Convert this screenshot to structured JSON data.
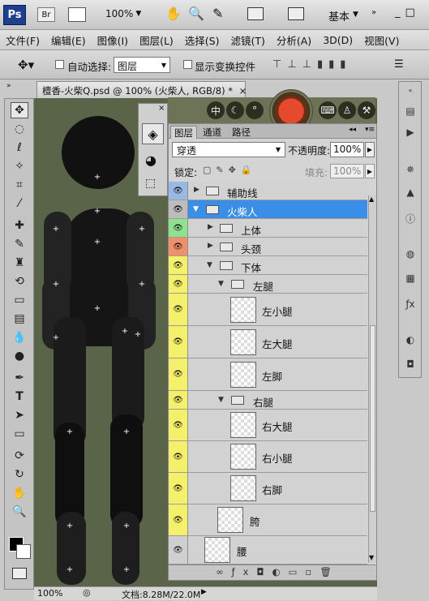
{
  "app": {
    "logo": "Ps",
    "bridge": "Br",
    "zoom": "100%",
    "workspace": "基本"
  },
  "menu": [
    "文件(F)",
    "编辑(E)",
    "图像(I)",
    "图层(L)",
    "选择(S)",
    "滤镜(T)",
    "分析(A)",
    "3D(D)",
    "视图(V)"
  ],
  "options": {
    "auto_select_label": "自动选择:",
    "auto_select_value": "图层",
    "show_transform_label": "显示变换控件"
  },
  "document": {
    "tab_title": "檀香-火柴Q.psd @ 100% (火柴人, RGB/8) *",
    "status_zoom": "100%",
    "status_doc": "文档:8.28M/22.0M"
  },
  "layers_panel": {
    "tabs": [
      "图层",
      "通道",
      "路径"
    ],
    "blend_mode": "穿透",
    "opacity_label": "不透明度:",
    "opacity_value": "100%",
    "lock_label": "锁定:",
    "fill_label": "填充:",
    "fill_value": "100%",
    "layers": [
      {
        "name": "辅助线",
        "kind": "group",
        "eye_color": "#9ab8e6"
      },
      {
        "name": "火柴人",
        "kind": "group",
        "eye_color": "#bdbdbd"
      },
      {
        "name": "上体",
        "kind": "group",
        "eye_color": "#8fe08f"
      },
      {
        "name": "头颈",
        "kind": "group",
        "eye_color": "#f0906a"
      },
      {
        "name": "下体",
        "kind": "group",
        "eye_color": "#f5f06a"
      },
      {
        "name": "左腿",
        "kind": "group",
        "eye_color": "#f5f06a"
      },
      {
        "name": "左小腿",
        "kind": "layer",
        "eye_color": "#f5f06a"
      },
      {
        "name": "左大腿",
        "kind": "layer",
        "eye_color": "#f5f06a"
      },
      {
        "name": "左脚",
        "kind": "layer",
        "eye_color": "#f5f06a"
      },
      {
        "name": "右腿",
        "kind": "group",
        "eye_color": "#f5f06a"
      },
      {
        "name": "右大腿",
        "kind": "layer",
        "eye_color": "#f5f06a"
      },
      {
        "name": "右小腿",
        "kind": "layer",
        "eye_color": "#f5f06a"
      },
      {
        "name": "右脚",
        "kind": "layer",
        "eye_color": "#f5f06a"
      },
      {
        "name": "胯",
        "kind": "layer",
        "eye_color": "#f5f06a"
      },
      {
        "name": "腰",
        "kind": "layer",
        "eye_color": "#cfcfcf"
      }
    ]
  },
  "banner": {
    "text_zh": "中"
  },
  "colors": {
    "canvas_bg": "#5a6448",
    "selected_row": "#3a8ee6",
    "figure": "#111111"
  }
}
